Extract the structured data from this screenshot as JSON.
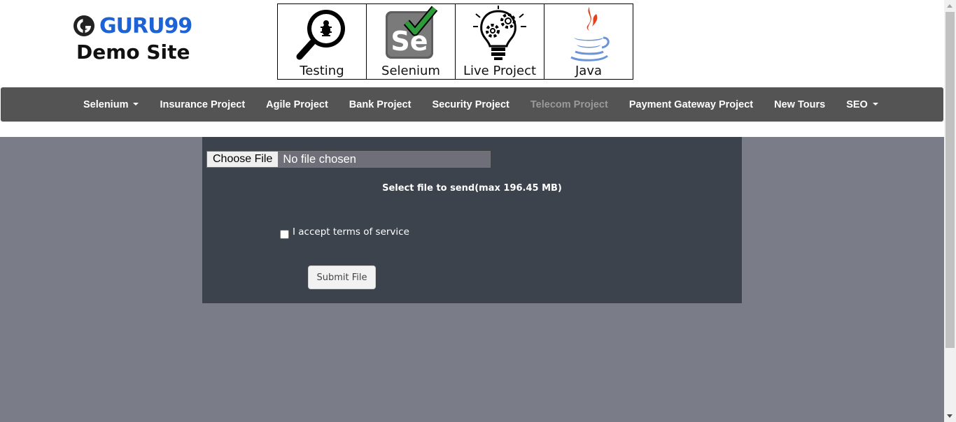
{
  "header": {
    "logo": {
      "brand": "GURU99",
      "subtitle": "Demo Site",
      "icon": "guru99-logo-icon"
    },
    "tiles": [
      {
        "label": "Testing",
        "icon": "magnifier-bug-icon"
      },
      {
        "label": "Selenium",
        "icon": "selenium-icon"
      },
      {
        "label": "Live Project",
        "icon": "lightbulb-gears-icon"
      },
      {
        "label": "Java",
        "icon": "java-cup-icon"
      }
    ]
  },
  "nav": {
    "items": [
      {
        "label": "Selenium",
        "dropdown": true
      },
      {
        "label": "Insurance Project"
      },
      {
        "label": "Agile Project"
      },
      {
        "label": "Bank Project"
      },
      {
        "label": "Security Project"
      },
      {
        "label": "Telecom Project",
        "active": true
      },
      {
        "label": "Payment Gateway Project"
      },
      {
        "label": "New Tours"
      },
      {
        "label": "SEO",
        "dropdown": true
      }
    ]
  },
  "upload": {
    "choose_button": "Choose File",
    "file_status": "No file chosen",
    "info": "Select file to send(max 196.45 MB)",
    "terms_label": "I accept terms of service",
    "terms_checked": false,
    "submit_label": "Submit File"
  },
  "colors": {
    "nav_bg": "#545454",
    "page_bg": "#7a7d87",
    "panel_bg": "#3c434d",
    "brand_blue": "#1e63d6"
  }
}
